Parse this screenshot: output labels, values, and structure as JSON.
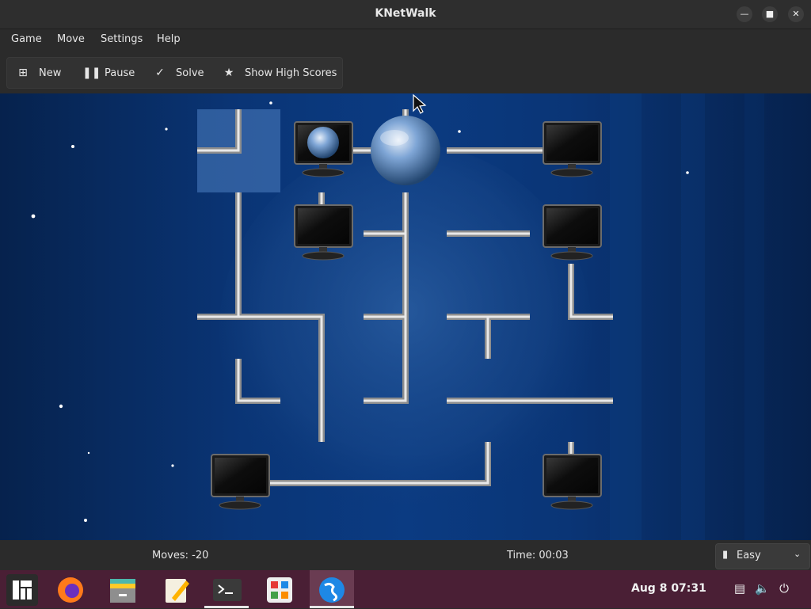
{
  "window": {
    "title": "KNetWalk"
  },
  "menu": [
    "Game",
    "Move",
    "Settings",
    "Help"
  ],
  "toolbar": {
    "new": "New",
    "pause": "Pause",
    "solve": "Solve",
    "highscores": "Show High Scores"
  },
  "status": {
    "moves": "Moves: -20",
    "time": "Time: 00:03",
    "difficulty": "Easy"
  },
  "taskbar": {
    "clock": "Aug 8  07:31"
  },
  "icons": [
    "minimize-icon",
    "maximize-icon",
    "close-icon",
    "new-icon",
    "pause-icon",
    "check-icon",
    "star-icon",
    "chart-icon",
    "chevron-down-icon",
    "manjaro-logo-icon",
    "firefox-icon",
    "files-icon",
    "text-editor-icon",
    "terminal-icon",
    "app-store-icon",
    "knetwalk-icon",
    "clipboard-icon",
    "volume-icon",
    "power-icon"
  ]
}
